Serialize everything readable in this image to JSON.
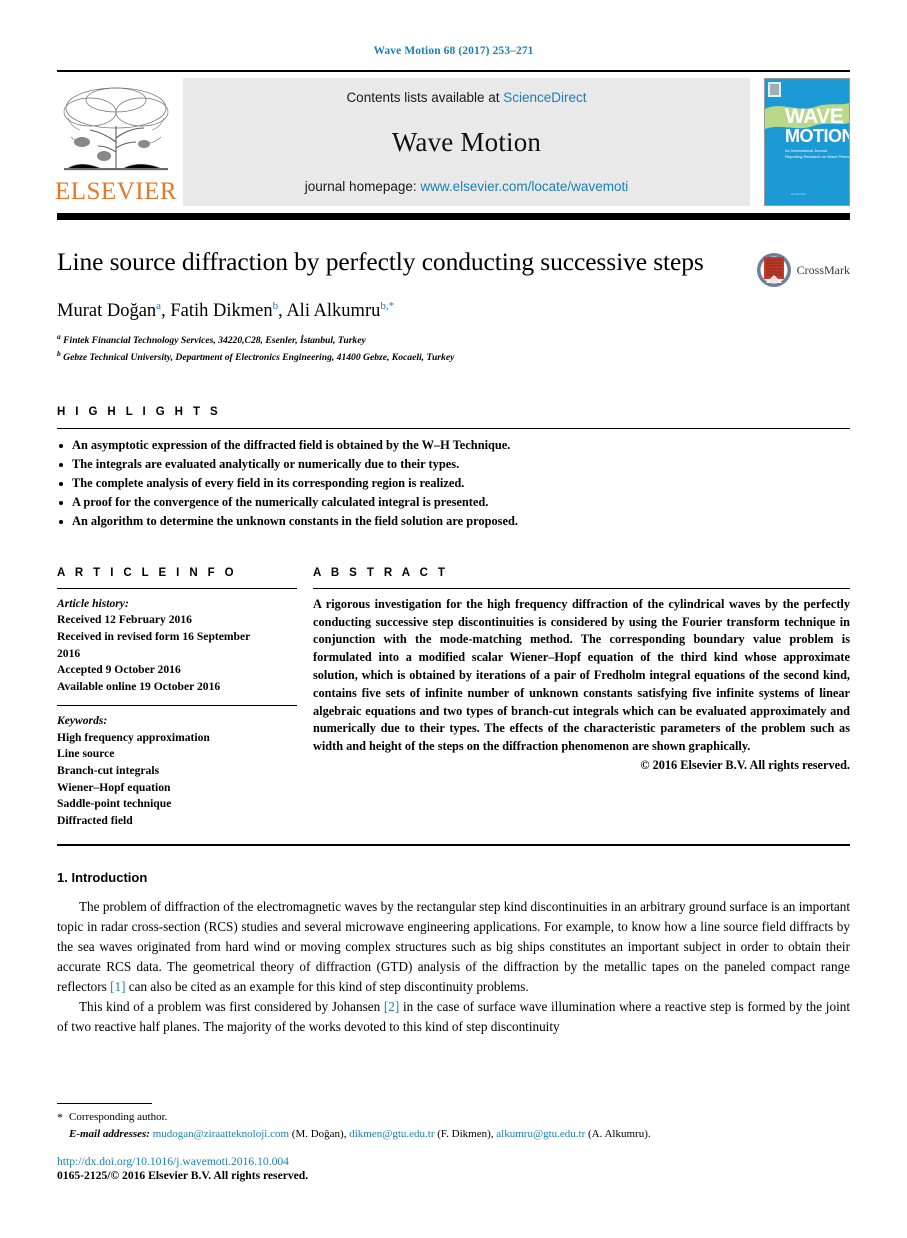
{
  "running_head": "Wave Motion 68 (2017) 253–271",
  "colors": {
    "link_blue": "#1a7fb5",
    "elsevier_orange": "#e87722",
    "masthead_gray": "#e9e9e9",
    "cover_blue": "#1b9ad6",
    "cover_green": "#b9d98a"
  },
  "masthead": {
    "publisher_name": "ELSEVIER",
    "contents_prefix": "Contents lists available at ",
    "contents_link": "ScienceDirect",
    "journal_name": "Wave Motion",
    "homepage_prefix": "journal homepage: ",
    "homepage_link": "www.elsevier.com/locate/wavemoti",
    "cover": {
      "line1": "WAVE",
      "line2": "MOTION",
      "subtitle1": "An International Journal",
      "subtitle2": "Reporting Research on Wave Phenomena"
    }
  },
  "article": {
    "title": "Line source diffraction by perfectly conducting successive steps",
    "crossmark_label": "CrossMark",
    "authors": [
      {
        "name": "Murat Doğan",
        "sup": "a",
        "sep": ", "
      },
      {
        "name": "Fatih Dikmen",
        "sup": "b",
        "sep": ", "
      },
      {
        "name": "Ali Alkumru",
        "sup": "b,*",
        "sep": ""
      }
    ],
    "affiliations": [
      {
        "marker": "a",
        "text": "Fintek Financial Technology Services, 34220,C28, Esenler, İstanbul, Turkey"
      },
      {
        "marker": "b",
        "text": "Gebze Technical University, Department of Electronics Engineering, 41400 Gebze, Kocaeli, Turkey"
      }
    ]
  },
  "highlights": {
    "heading": "H I G H L I G H T S",
    "items": [
      "An asymptotic expression of the diffracted field is obtained by the W–H Technique.",
      "The integrals are evaluated analytically or numerically due to their types.",
      "The complete analysis of every field in its corresponding region is realized.",
      "A proof for the convergence of the numerically calculated integral is presented.",
      "An algorithm to determine the unknown constants in the field solution are proposed."
    ]
  },
  "article_info": {
    "heading": "A R T I C L E    I N F O",
    "history_label": "Article history:",
    "history": [
      "Received 12 February 2016",
      "Received in revised form 16 September",
      "2016",
      "Accepted 9 October 2016",
      "Available online 19 October 2016"
    ],
    "keywords_label": "Keywords:",
    "keywords": [
      "High frequency approximation",
      "Line source",
      "Branch-cut integrals",
      "Wiener–Hopf equation",
      "Saddle-point technique",
      "Diffracted field"
    ]
  },
  "abstract": {
    "heading": "A B S T R A C T",
    "text": "A rigorous investigation for the high frequency diffraction of the cylindrical waves by the perfectly conducting successive step discontinuities is considered by using the Fourier transform technique in conjunction with the mode-matching method. The corresponding boundary value problem is formulated into a modified scalar Wiener–Hopf equation of the third kind whose approximate solution, which is obtained by iterations of a pair of Fredholm integral equations of the second kind, contains five sets of infinite number of unknown constants satisfying five infinite systems of linear algebraic equations and two types of branch-cut integrals which can be evaluated approximately and numerically due to their types. The effects of the characteristic parameters of the problem such as width and height of the steps on the diffraction phenomenon are shown graphically.",
    "copyright": "© 2016 Elsevier B.V. All rights reserved."
  },
  "body": {
    "section_number_title": "1. Introduction",
    "paragraph_1_part1": "The problem of diffraction of the electromagnetic waves by the rectangular step kind discontinuities in an arbitrary ground surface is an important topic in radar cross-section (RCS) studies and several microwave engineering applications. For example, to know how a line source field diffracts by the sea waves originated from hard wind or moving complex structures such as big ships constitutes an important subject in order to obtain their accurate RCS data. The geometrical theory of diffraction (GTD) analysis of the diffraction by the metallic tapes on the paneled compact range reflectors ",
    "paragraph_1_ref": "[1]",
    "paragraph_1_part2": " can also be cited as an example for this kind of step discontinuity problems.",
    "paragraph_2_part1": "This kind of a problem was first considered by Johansen ",
    "paragraph_2_ref": "[2]",
    "paragraph_2_part2": " in the case of surface wave illumination where a reactive step is formed by the joint of two reactive half planes. The majority of the works devoted to this kind of step discontinuity"
  },
  "footnotes": {
    "corresponding_star": "*",
    "corresponding_text": "Corresponding author.",
    "email_label": "E-mail addresses:",
    "emails": [
      {
        "address": "mudogan@ziraatteknoloji.com",
        "owner": "(M. Doğan)",
        "sep": ", "
      },
      {
        "address": "dikmen@gtu.edu.tr",
        "owner": "(F. Dikmen)",
        "sep": ", "
      },
      {
        "address": "alkumru@gtu.edu.tr",
        "owner": "(A. Alkumru)",
        "sep": "."
      }
    ],
    "doi": "http://dx.doi.org/10.1016/j.wavemoti.2016.10.004",
    "issn_line": "0165-2125/© 2016 Elsevier B.V. All rights reserved."
  }
}
